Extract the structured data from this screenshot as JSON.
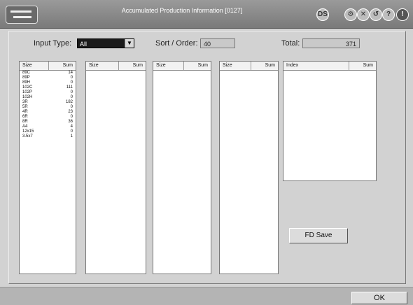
{
  "window": {
    "title": "Accumulated Production Information [0127]"
  },
  "toolbar": {
    "icons": [
      "ds-icon",
      "tools-icon",
      "cancel-icon",
      "back-icon",
      "help-icon",
      "alert-icon"
    ]
  },
  "filters": {
    "input_type_label": "Input Type:",
    "input_type_value": "All",
    "sort_label": "Sort / Order:",
    "sort_value": "40",
    "total_label": "Total:",
    "total_value": "371"
  },
  "lists": [
    {
      "col1": "Size",
      "col2": "Sum",
      "rows": [
        {
          "size": "89C",
          "sum": "14"
        },
        {
          "size": "89P",
          "sum": "0"
        },
        {
          "size": "89H",
          "sum": "0"
        },
        {
          "size": "102C",
          "sum": "111"
        },
        {
          "size": "102P",
          "sum": "0"
        },
        {
          "size": "102H",
          "sum": "0"
        },
        {
          "size": "3R",
          "sum": "182"
        },
        {
          "size": "5R",
          "sum": "0"
        },
        {
          "size": "4R",
          "sum": "23"
        },
        {
          "size": "6R",
          "sum": "0"
        },
        {
          "size": "8R",
          "sum": "36"
        },
        {
          "size": "A4",
          "sum": "4"
        },
        {
          "size": "12x15",
          "sum": "0"
        },
        {
          "size": "3.5x7",
          "sum": "1"
        }
      ]
    },
    {
      "col1": "Size",
      "col2": "Sum",
      "rows": []
    },
    {
      "col1": "Size",
      "col2": "Sum",
      "rows": []
    },
    {
      "col1": "Size",
      "col2": "Sum",
      "rows": []
    },
    {
      "col1": "Index",
      "col2": "Sum",
      "rows": []
    }
  ],
  "buttons": {
    "fd_save": "FD Save",
    "ok": "OK"
  }
}
